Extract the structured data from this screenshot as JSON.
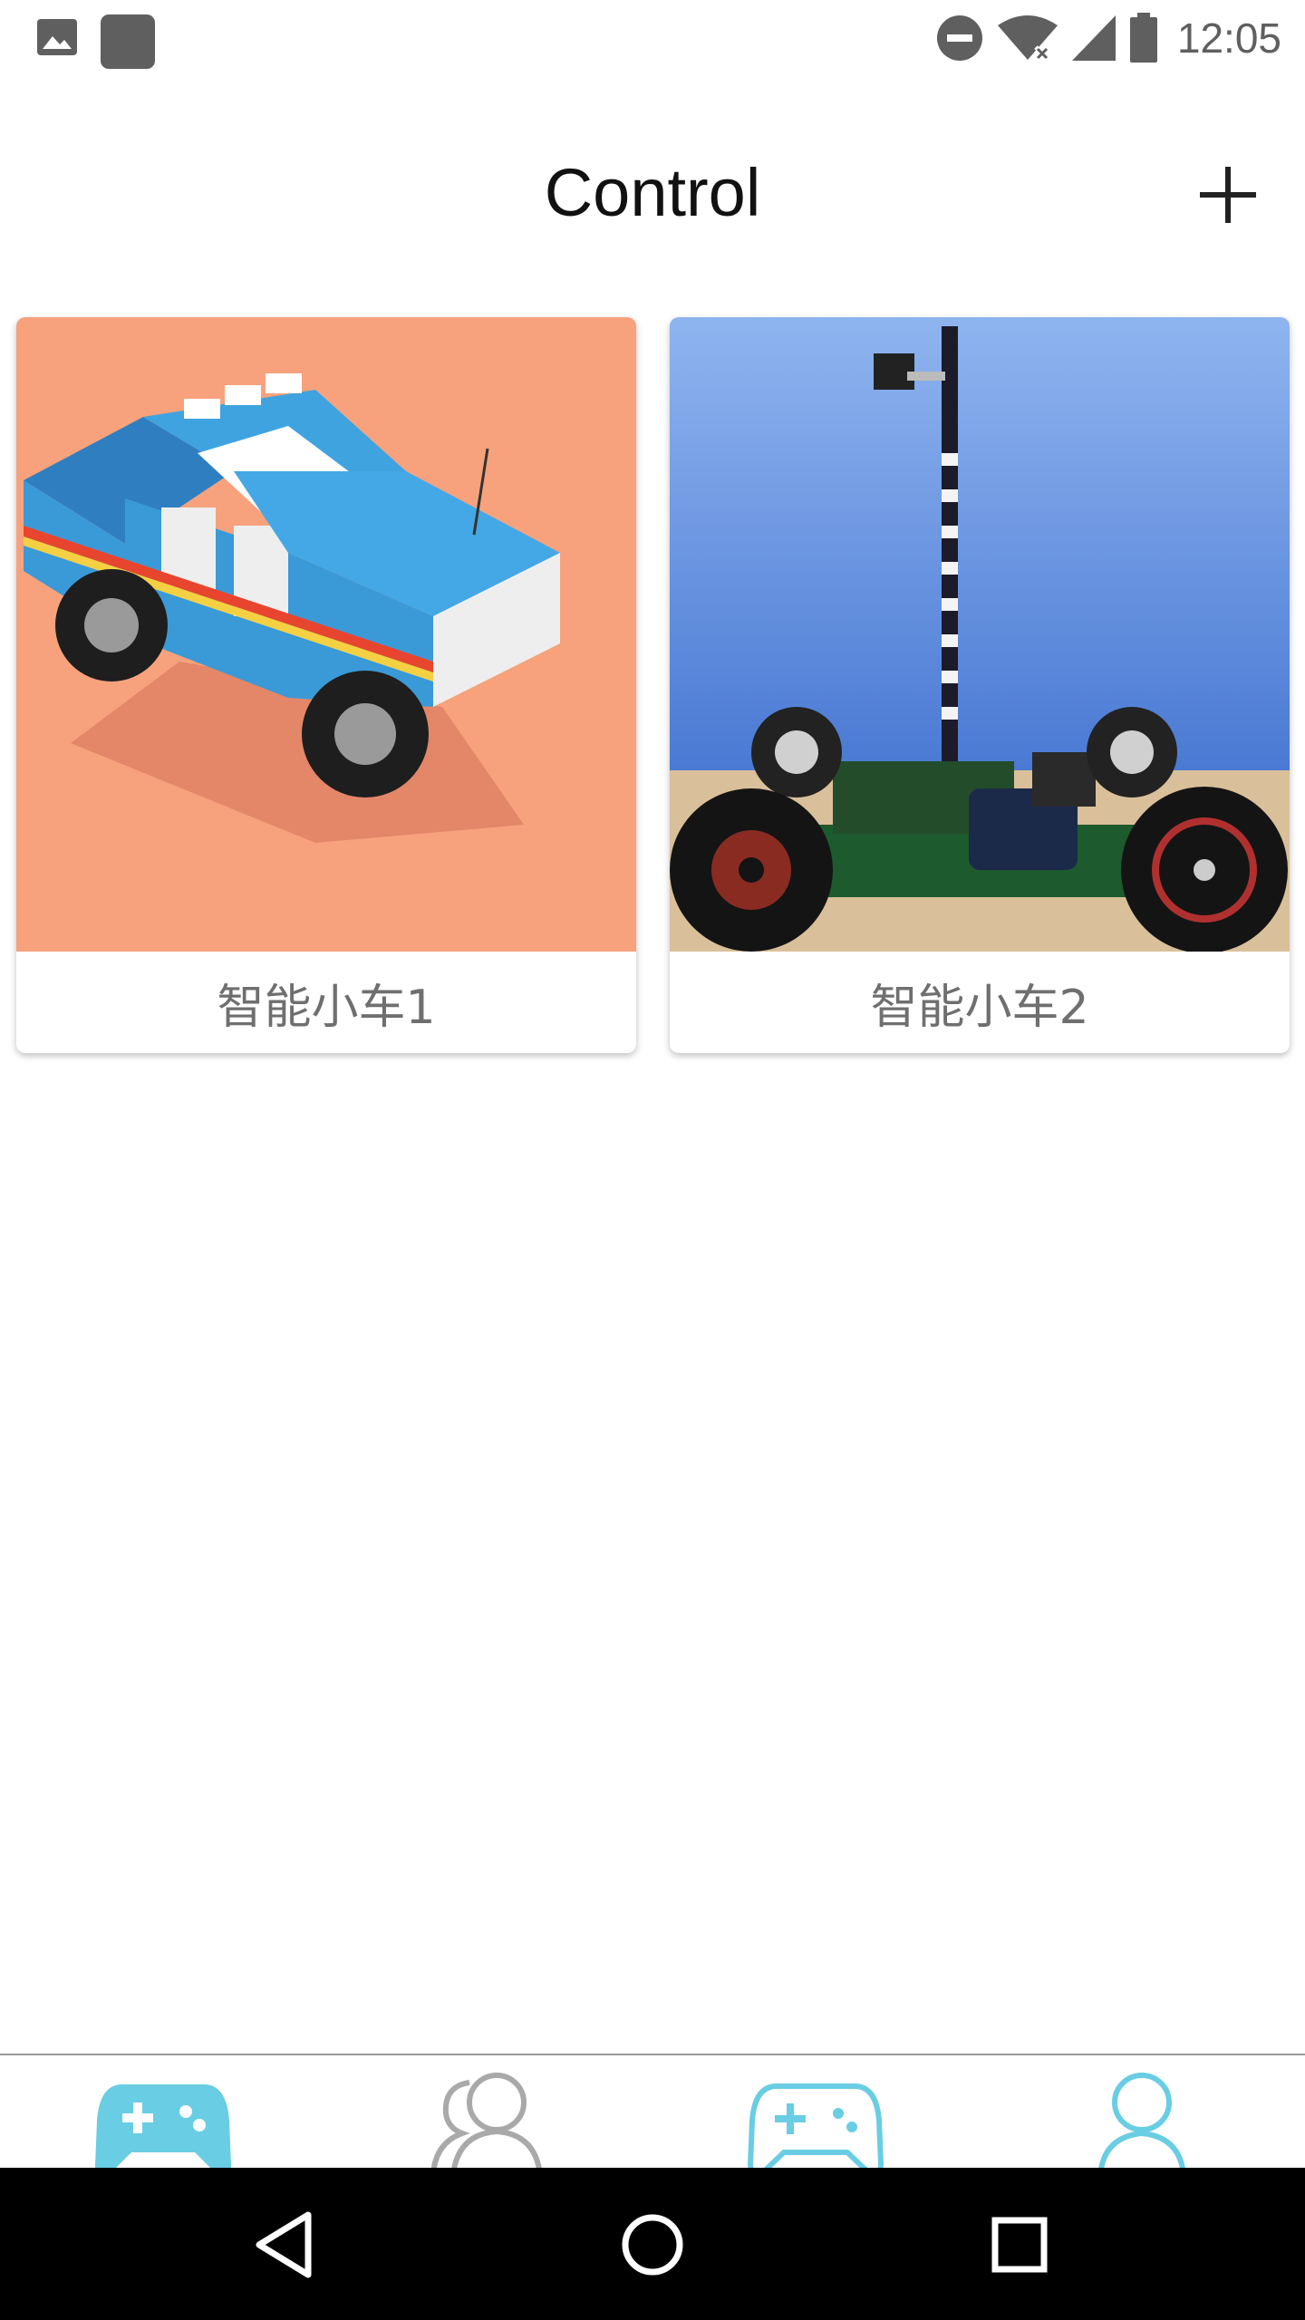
{
  "status_bar": {
    "time": "12:05",
    "icons": [
      "image-icon",
      "app-icon",
      "do-not-disturb-icon",
      "wifi-icon",
      "signal-icon",
      "battery-icon"
    ]
  },
  "header": {
    "title": "Control",
    "add_icon": "plus-icon"
  },
  "devices": [
    {
      "name": "智能小车1",
      "image": "toy-truck"
    },
    {
      "name": "智能小车2",
      "image": "robot-car"
    }
  ],
  "tabbar": {
    "tabs": [
      {
        "icon": "gamepad-filled-icon",
        "active": true
      },
      {
        "icon": "users-icon",
        "active": false
      },
      {
        "icon": "gamepad-outline-icon",
        "active": false
      },
      {
        "icon": "user-icon",
        "active": false
      }
    ],
    "colors": {
      "accent": "#69cde4",
      "inactive": "#a9a9a9"
    }
  },
  "navbar": {
    "buttons": [
      "back-icon",
      "home-icon",
      "recents-icon"
    ]
  }
}
